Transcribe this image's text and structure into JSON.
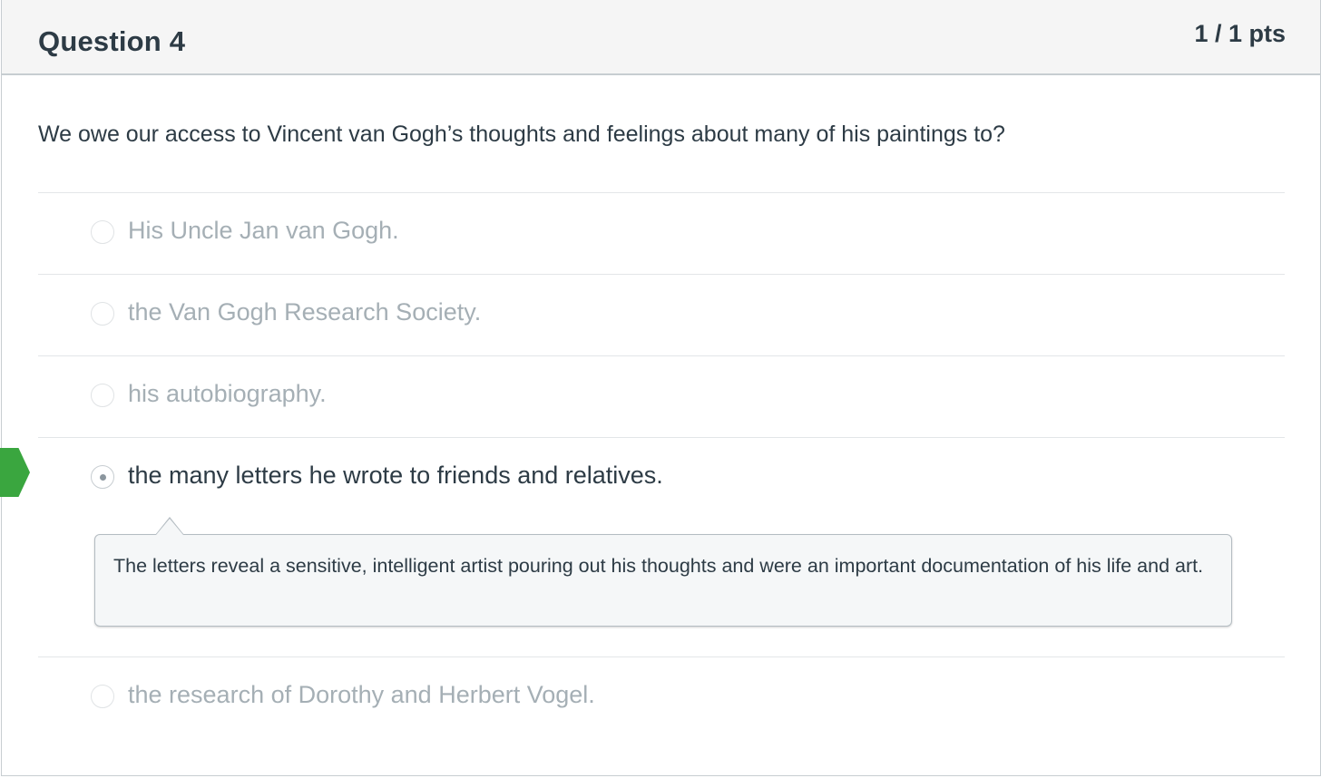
{
  "question": {
    "title": "Question 4",
    "points": "1 / 1 pts",
    "text": "We owe our access to Vincent van Gogh’s thoughts and feelings about many of his paintings to?"
  },
  "answers": [
    {
      "label": "His Uncle Jan van Gogh.",
      "selected": false
    },
    {
      "label": "the Van Gogh Research Society.",
      "selected": false
    },
    {
      "label": "his autobiography.",
      "selected": false
    },
    {
      "label": "the many letters he wrote to friends and relatives.",
      "selected": true,
      "correct": true
    },
    {
      "label": "the research of Dorothy and Herbert Vogel.",
      "selected": false
    }
  ],
  "feedback": {
    "text": "The letters reveal a sensitive, intelligent artist pouring out his thoughts and were an important documentation of his life and art."
  },
  "colors": {
    "correct_indicator": "#3aa63f",
    "text_primary": "#2d3b45",
    "text_muted": "#a5afb5",
    "header_bg": "#f5f5f5"
  }
}
